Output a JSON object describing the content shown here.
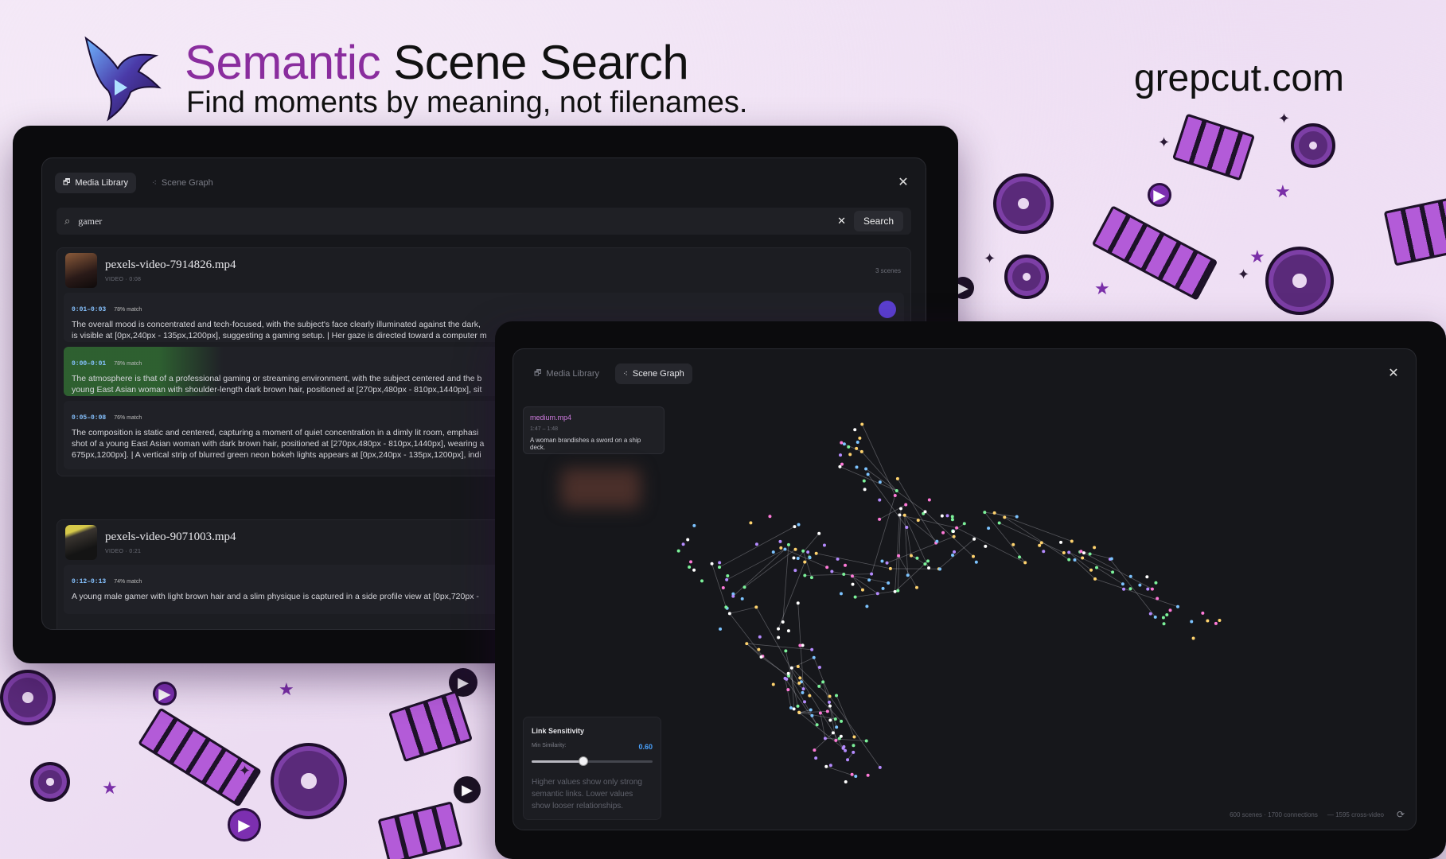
{
  "hero": {
    "title_accent": "Semantic",
    "title_rest": "Scene Search",
    "subtitle": "Find moments by meaning, not filenames.",
    "site": "grepcut.com"
  },
  "left_app": {
    "tabs": [
      {
        "label": "Media Library",
        "icon": "library-icon",
        "active": true
      },
      {
        "label": "Scene Graph",
        "icon": "graph-icon",
        "active": false
      }
    ],
    "search": {
      "query": "gamer",
      "button_label": "Search"
    },
    "videos": [
      {
        "name": "pexels-video-7914826.mp4",
        "type": "VIDEO",
        "duration": "0:08",
        "scene_count": "3 scenes",
        "scenes": [
          {
            "time": "0:01–0:03",
            "match": "78% match",
            "line1": "The overall mood is concentrated and tech-focused, with the subject's face clearly illuminated against the dark,",
            "line2": "is visible at [0px,240px - 135px,1200px], suggesting a gaming setup. | Her gaze is directed toward a computer m"
          },
          {
            "time": "0:00–0:01",
            "match": "78% match",
            "line1": "The atmosphere is that of a professional gaming or streaming environment, with the subject centered and the b",
            "line2": "young East Asian woman with shoulder-length dark brown hair, positioned at [270px,480px - 810px,1440px], sit"
          },
          {
            "time": "0:05–0:08",
            "match": "76% match",
            "line1": "The composition is static and centered, capturing a moment of quiet concentration in a dimly lit room, emphasi",
            "line2": "shot of a young East Asian woman with dark brown hair, positioned at [270px,480px - 810px,1440px], wearing a",
            "line3": "675px,1200px]. | A vertical strip of blurred green neon bokeh lights appears at [0px,240px - 135px,1200px], indi"
          }
        ]
      },
      {
        "name": "pexels-video-9071003.mp4",
        "type": "VIDEO",
        "duration": "0:21",
        "scenes": [
          {
            "time": "0:12–0:13",
            "match": "74% match",
            "line1": "A young male gamer with light brown hair and a slim physique is captured in a side profile view at [0px,720px -"
          }
        ]
      }
    ]
  },
  "right_app": {
    "tabs": [
      {
        "label": "Media Library",
        "icon": "library-icon",
        "active": false
      },
      {
        "label": "Scene Graph",
        "icon": "graph-icon",
        "active": true
      }
    ],
    "tooltip": {
      "file": "medium.mp4",
      "time": "1:47 – 1:48",
      "desc": "A woman brandishes a sword on a ship deck."
    },
    "link_panel": {
      "title": "Link Sensitivity",
      "label": "Min Similarity:",
      "value": "0.60",
      "level": 0.6,
      "note": "Higher values show only strong semantic links. Lower values show looser relationships."
    },
    "stats": {
      "scenes": "600 scenes · 1700 connections",
      "cross": "— 1595 cross-video"
    }
  },
  "colors": {
    "accent": "#8a2d9e",
    "link_value": "#4aa3ff",
    "tooltip_file": "#d07be0"
  }
}
